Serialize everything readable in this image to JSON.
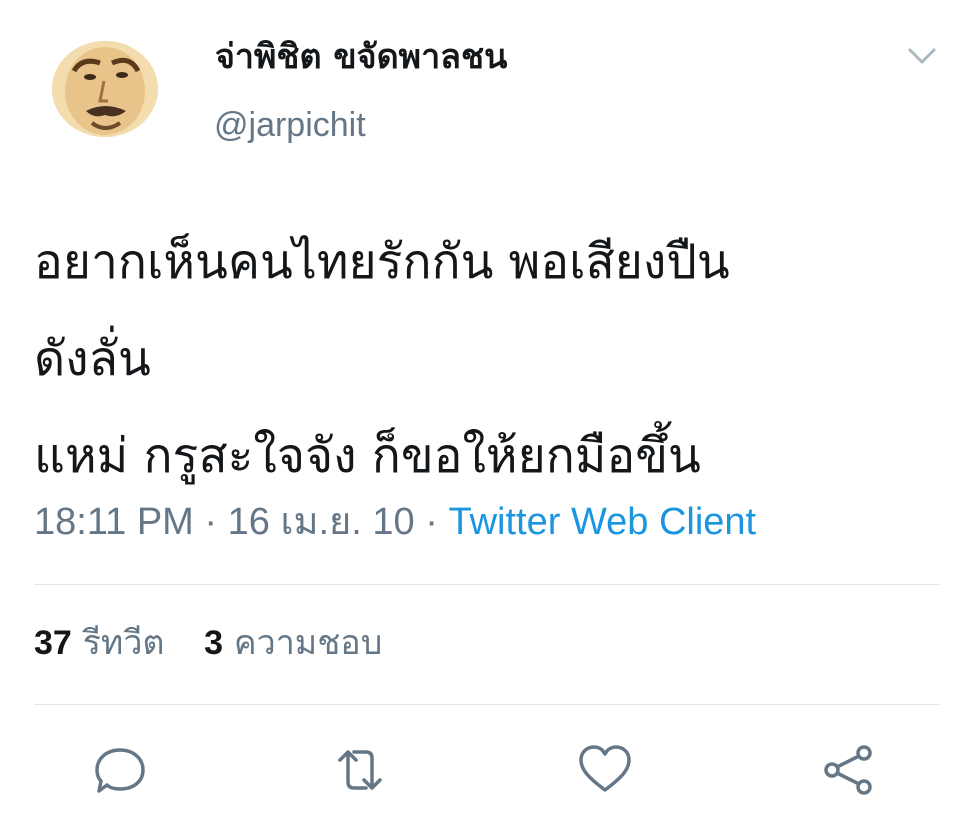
{
  "user": {
    "display_name": "จ่าพิชิต ขจัดพาลชน",
    "handle": "@jarpichit"
  },
  "tweet": {
    "lines": [
      "อยากเห็นคนไทยรักกัน พอเสียงปืน",
      "ดังลั่น",
      "แหม่ กรูสะใจจัง ก็ขอให้ยกมือขึ้น"
    ],
    "time": "18:11 PM",
    "separator": "·",
    "date": "16 เม.ย. 10",
    "source": "Twitter Web Client"
  },
  "stats": {
    "retweets_count": "37",
    "retweets_label": "รีทวีต",
    "likes_count": "3",
    "likes_label": "ความชอบ"
  },
  "icons": {
    "menu": "chevron-down-icon",
    "reply": "reply-icon",
    "retweet": "retweet-icon",
    "like": "heart-icon",
    "share": "share-icon"
  },
  "colors": {
    "text": "#14171a",
    "secondary": "#657786",
    "link": "#1b95e0",
    "divider": "#e1e8ed"
  }
}
